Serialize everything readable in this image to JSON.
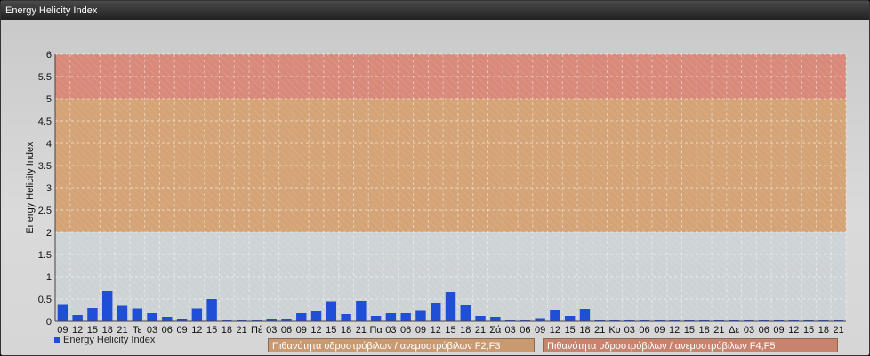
{
  "window": {
    "title": "Energy Helicity Index"
  },
  "colors": {
    "bar": "#1f4fd6",
    "band_low": "#d4a376",
    "band_high": "#d8897a",
    "band_base": "#c7cfd4"
  },
  "legend": {
    "series_label": "Energy Helicity Index",
    "band1_label": "Πιθανότητα υδροστρόβιλων / ανεμοστρόβιλων F2,F3",
    "band2_label": "Πιθανότητα υδροστρόβιλων / ανεμοστρόβιλων F4,F5"
  },
  "chart_data": {
    "type": "bar",
    "ylabel": "Energy Helicity Index",
    "ylim": [
      0,
      6
    ],
    "yticks": [
      "0",
      "0.5",
      "1",
      "1.5",
      "2",
      "2.5",
      "3",
      "3.5",
      "4",
      "4.5",
      "5",
      "5.5",
      "6"
    ],
    "bands": [
      {
        "from": 2,
        "to": 5,
        "label": "Πιθανότητα υδροστρόβιλων / ανεμοστρόβιλων F2,F3"
      },
      {
        "from": 5,
        "to": 6,
        "label": "Πιθανότητα υδροστρόβιλων / ανεμοστρόβιλων F4,F5"
      }
    ],
    "categories": [
      "09",
      "12",
      "15",
      "18",
      "21",
      "Τε",
      "03",
      "06",
      "09",
      "12",
      "15",
      "18",
      "21",
      "Πέ",
      "03",
      "06",
      "09",
      "12",
      "15",
      "18",
      "21",
      "Πα",
      "03",
      "06",
      "09",
      "12",
      "15",
      "18",
      "21",
      "Σά",
      "03",
      "06",
      "09",
      "12",
      "15",
      "18",
      "21",
      "Κυ",
      "03",
      "06",
      "09",
      "12",
      "15",
      "18",
      "21",
      "Δε",
      "03",
      "06",
      "09",
      "12",
      "15",
      "18",
      "21"
    ],
    "series": [
      {
        "name": "Energy Helicity Index",
        "values": [
          0.37,
          0.14,
          0.3,
          0.68,
          0.35,
          0.29,
          0.18,
          0.1,
          0.06,
          0.29,
          0.5,
          0.02,
          0.04,
          0.04,
          0.06,
          0.06,
          0.18,
          0.24,
          0.45,
          0.16,
          0.46,
          0.12,
          0.18,
          0.18,
          0.25,
          0.42,
          0.66,
          0.36,
          0.12,
          0.1,
          0.03,
          0.02,
          0.07,
          0.26,
          0.12,
          0.28,
          0.02,
          0.02,
          0.02,
          0.02,
          0.02,
          0.02,
          0.02,
          0.02,
          0.02,
          0.02,
          0.02,
          0.02,
          0.02,
          0.02,
          0.02,
          0.02,
          0.02
        ]
      }
    ],
    "grid": true,
    "legend_position": "bottom-left"
  }
}
